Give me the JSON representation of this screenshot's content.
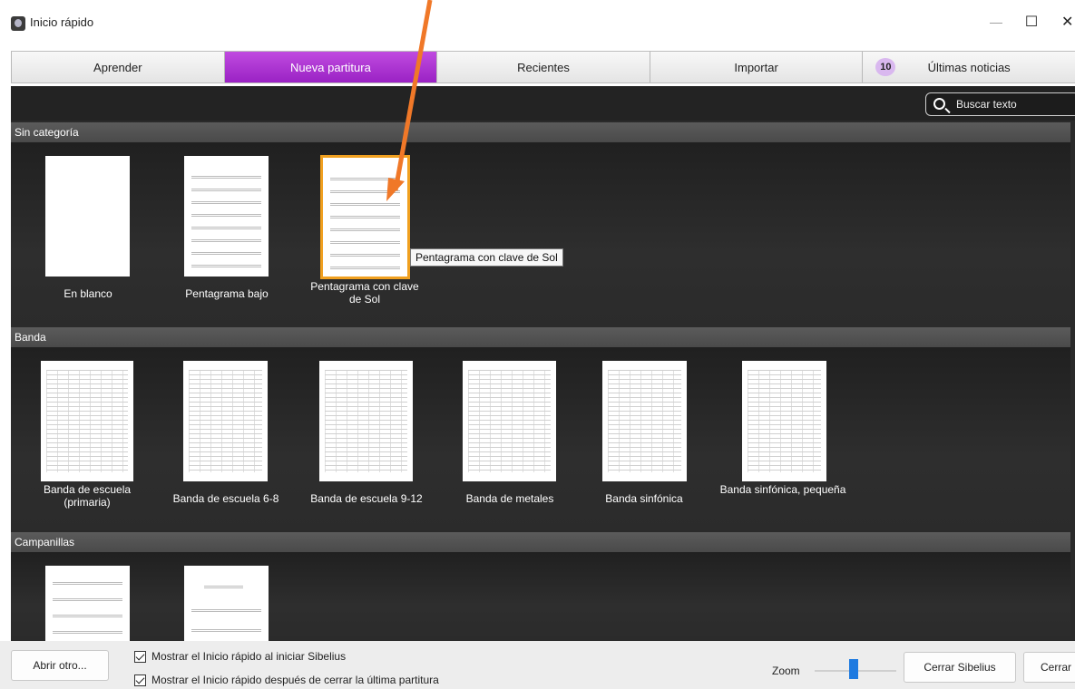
{
  "window": {
    "title": "Inicio rápido",
    "minimize_glyph": "—",
    "maximize_glyph": "☐",
    "close_glyph": "✕"
  },
  "tabs": [
    {
      "label": "Aprender",
      "active": false
    },
    {
      "label": "Nueva partitura",
      "active": true
    },
    {
      "label": "Recientes",
      "active": false
    },
    {
      "label": "Importar",
      "active": false
    },
    {
      "label": "Últimas noticias",
      "active": false,
      "badge": "10"
    }
  ],
  "search": {
    "placeholder": "Buscar texto",
    "icon": "search-icon"
  },
  "categories": [
    {
      "name": "Sin categoría",
      "templates": [
        {
          "label": "En blanco"
        },
        {
          "label": "Pentagrama bajo"
        },
        {
          "label": "Pentagrama con clave de Sol",
          "selected": true
        }
      ]
    },
    {
      "name": "Banda",
      "templates": [
        {
          "label": "Banda de escuela (primaria)"
        },
        {
          "label": "Banda de escuela 6-8"
        },
        {
          "label": "Banda de escuela 9-12"
        },
        {
          "label": "Banda de metales"
        },
        {
          "label": "Banda sinfónica"
        },
        {
          "label": "Banda sinfónica, pequeña"
        }
      ]
    },
    {
      "name": "Campanillas",
      "templates": []
    }
  ],
  "tooltip": "Pentagrama con clave de Sol",
  "footer": {
    "open_other_button": "Abrir otro...",
    "checkbox_startup": "Mostrar el Inicio rápido al iniciar Sibelius",
    "checkbox_after_close": "Mostrar el Inicio rápido después de cerrar la última partitura",
    "zoom_label": "Zoom",
    "close_sibelius_button": "Cerrar Sibelius",
    "close_button": "Cerrar"
  },
  "colors": {
    "active_tab": "#a52fd0",
    "selection": "#f0a020",
    "annotation_arrow": "#f07828",
    "zoom_thumb": "#1e7ae0"
  }
}
